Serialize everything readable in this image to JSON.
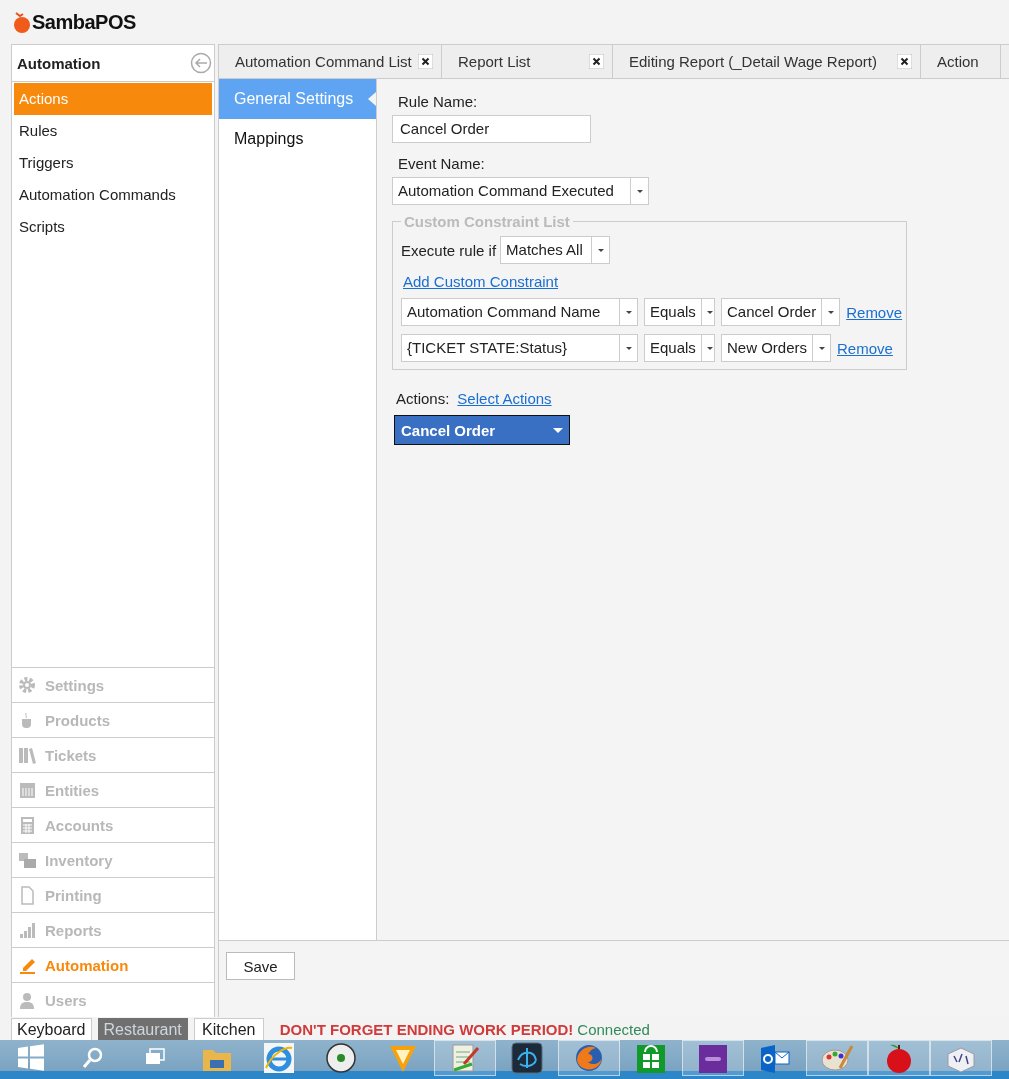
{
  "app": {
    "title": "SambaPOS"
  },
  "sidebar": {
    "title": "Automation",
    "items": [
      {
        "label": "Actions",
        "selected": true
      },
      {
        "label": "Rules",
        "selected": false
      },
      {
        "label": "Triggers",
        "selected": false
      },
      {
        "label": "Automation Commands",
        "selected": false
      },
      {
        "label": "Scripts",
        "selected": false
      }
    ],
    "sections": [
      {
        "label": "Settings",
        "kind": "gear",
        "selected": false
      },
      {
        "label": "Products",
        "kind": "cup",
        "selected": false
      },
      {
        "label": "Tickets",
        "kind": "books",
        "selected": false
      },
      {
        "label": "Entities",
        "kind": "grid",
        "selected": false
      },
      {
        "label": "Accounts",
        "kind": "calculator",
        "selected": false
      },
      {
        "label": "Inventory",
        "kind": "boxes",
        "selected": false
      },
      {
        "label": "Printing",
        "kind": "page",
        "selected": false
      },
      {
        "label": "Reports",
        "kind": "bars",
        "selected": false
      },
      {
        "label": "Automation",
        "kind": "pencil",
        "selected": true
      },
      {
        "label": "Users",
        "kind": "user",
        "selected": false
      }
    ]
  },
  "tabs": [
    {
      "label": "Automation Command List",
      "closable": true
    },
    {
      "label": "Report List",
      "closable": true
    },
    {
      "label": "Editing Report (_Detail Wage Report)",
      "closable": true
    },
    {
      "label": "Action",
      "closable": false
    }
  ],
  "subnav": [
    {
      "label": "General Settings",
      "selected": true
    },
    {
      "label": "Mappings",
      "selected": false
    }
  ],
  "form": {
    "rule_name_label": "Rule Name:",
    "rule_name": "Cancel Order",
    "event_label": "Event Name:",
    "event": "Automation Command Executed",
    "constraints": {
      "legend": "Custom Constraint List",
      "execute_label": "Execute rule if",
      "match": "Matches All",
      "add_link": "Add Custom Constraint",
      "rows": [
        {
          "name": "Automation Command Name",
          "operator": "Equals",
          "value": "Cancel Order",
          "remove": "Remove"
        },
        {
          "name": "{TICKET STATE:Status}",
          "operator": "Equals",
          "value": "New Orders",
          "remove": "Remove"
        }
      ]
    },
    "actions_label": "Actions:",
    "select_link": "Select Actions",
    "actions": [
      {
        "label": "Cancel Order"
      }
    ],
    "save": "Save"
  },
  "footer": {
    "buttons": [
      {
        "label": "Keyboard",
        "selected": false
      },
      {
        "label": "Restaurant",
        "selected": true
      },
      {
        "label": "Kitchen",
        "selected": false
      }
    ],
    "message": "DON'T FORGET ENDING WORK PERIOD!",
    "status": "Connected"
  },
  "taskbar": {
    "items": [
      {
        "kind": "start",
        "running": false
      },
      {
        "kind": "search",
        "running": false
      },
      {
        "kind": "taskview",
        "running": false
      },
      {
        "kind": "explorer",
        "running": false
      },
      {
        "kind": "ie",
        "running": false
      },
      {
        "kind": "disc",
        "running": false
      },
      {
        "kind": "chevron",
        "running": false
      },
      {
        "kind": "notepad",
        "running": true
      },
      {
        "kind": "swirl",
        "running": false
      },
      {
        "kind": "firefox",
        "running": true
      },
      {
        "kind": "store",
        "running": false
      },
      {
        "kind": "purple",
        "running": true
      },
      {
        "kind": "mail",
        "running": false
      },
      {
        "kind": "palette",
        "running": true
      },
      {
        "kind": "apple",
        "running": true
      },
      {
        "kind": "cube",
        "running": true
      }
    ]
  }
}
